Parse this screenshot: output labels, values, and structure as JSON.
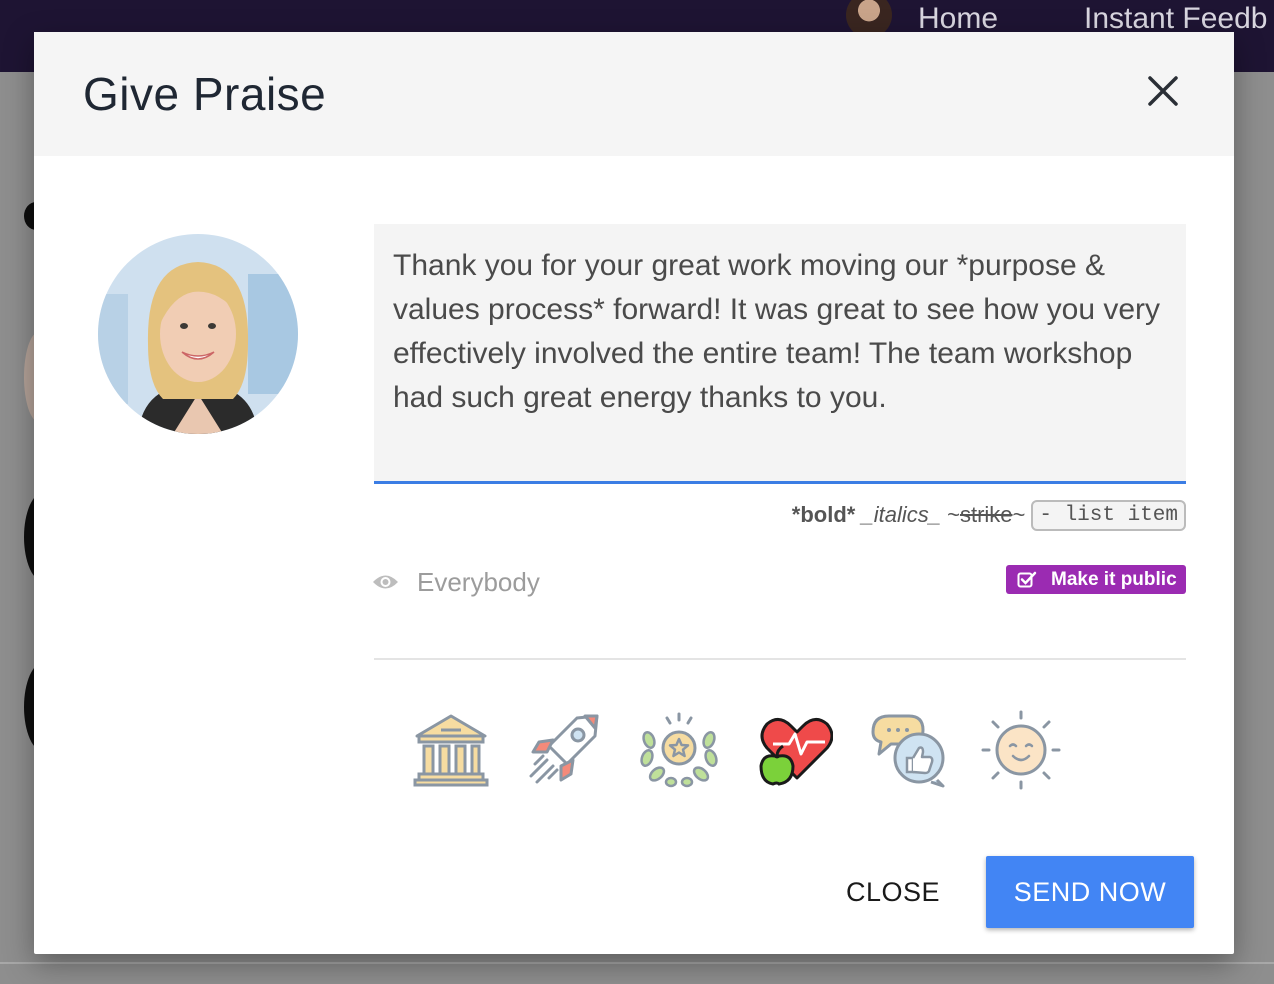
{
  "nav": {
    "home_label": "Home",
    "instant_feedback_label": "Instant Feedb"
  },
  "modal": {
    "title": "Give Praise",
    "close_icon": "close-icon"
  },
  "message": {
    "text": "Thank you for your great work moving our *purpose & values process* forward! It was great to see how you very effectively involved the entire team! The team workshop had such great energy thanks to you."
  },
  "format_hint": {
    "bold": "*bold*",
    "italics": "_italics_",
    "strike_open": "~",
    "strike": "strike",
    "strike_close": "~",
    "list_item": "- list item"
  },
  "visibility": {
    "icon": "eye-icon",
    "label": "Everybody"
  },
  "public_badge": {
    "icon": "checkbox-checked-icon",
    "label": "Make it public",
    "color": "#9b2bb2"
  },
  "values": [
    {
      "icon": "bank-building-icon"
    },
    {
      "icon": "rocket-icon"
    },
    {
      "icon": "laurel-star-icon"
    },
    {
      "icon": "heart-apple-icon"
    },
    {
      "icon": "speech-thumbs-up-icon"
    },
    {
      "icon": "sun-smile-icon"
    }
  ],
  "actions": {
    "close_label": "CLOSE",
    "send_label": "SEND NOW",
    "send_color": "#4285f4"
  }
}
